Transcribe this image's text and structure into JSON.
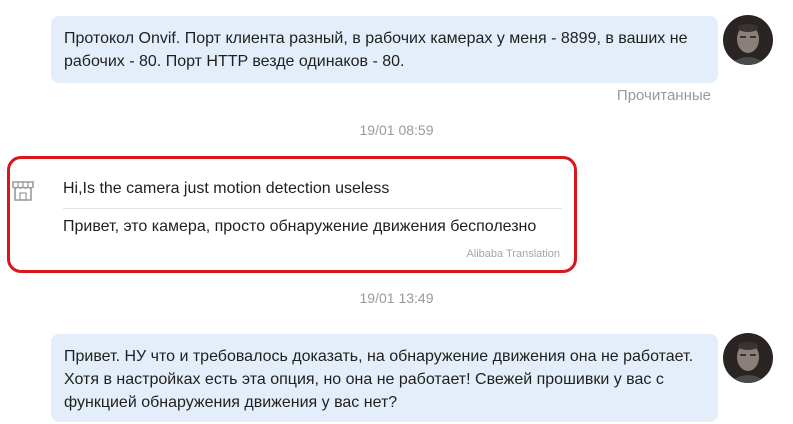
{
  "messages": [
    {
      "id": "msg1",
      "direction": "outgoing",
      "text": "Протокол Onvif. Порт клиента разный, в рабочих камерах у меня - 8899, в ваших не рабочих - 80. Порт HTTP везде одинаков - 80.",
      "status": "Прочитанные"
    },
    {
      "id": "msg2",
      "direction": "incoming",
      "timestamp": "19/01 08:59",
      "original": "Hi,Is the camera just motion detection useless",
      "translation": "Привет, это камера, просто обнаружение движения бесполезно",
      "translation_source": "Alibaba Translation"
    },
    {
      "id": "msg3",
      "direction": "outgoing",
      "timestamp": "19/01 13:49",
      "text": "Привет. НУ что и требовалось доказать, на обнаружение движения она не работает. Хотя в настройках есть эта опция, но она не работает! Свежей прошивки у вас с функцией обнаружения движения у вас нет?"
    }
  ],
  "colors": {
    "outgoing_bubble": "#e4eefb",
    "highlight_border": "#d9161c",
    "meta_text": "#9a9a9a"
  },
  "icons": {
    "sender": "shop-icon",
    "avatar": "user-avatar"
  }
}
